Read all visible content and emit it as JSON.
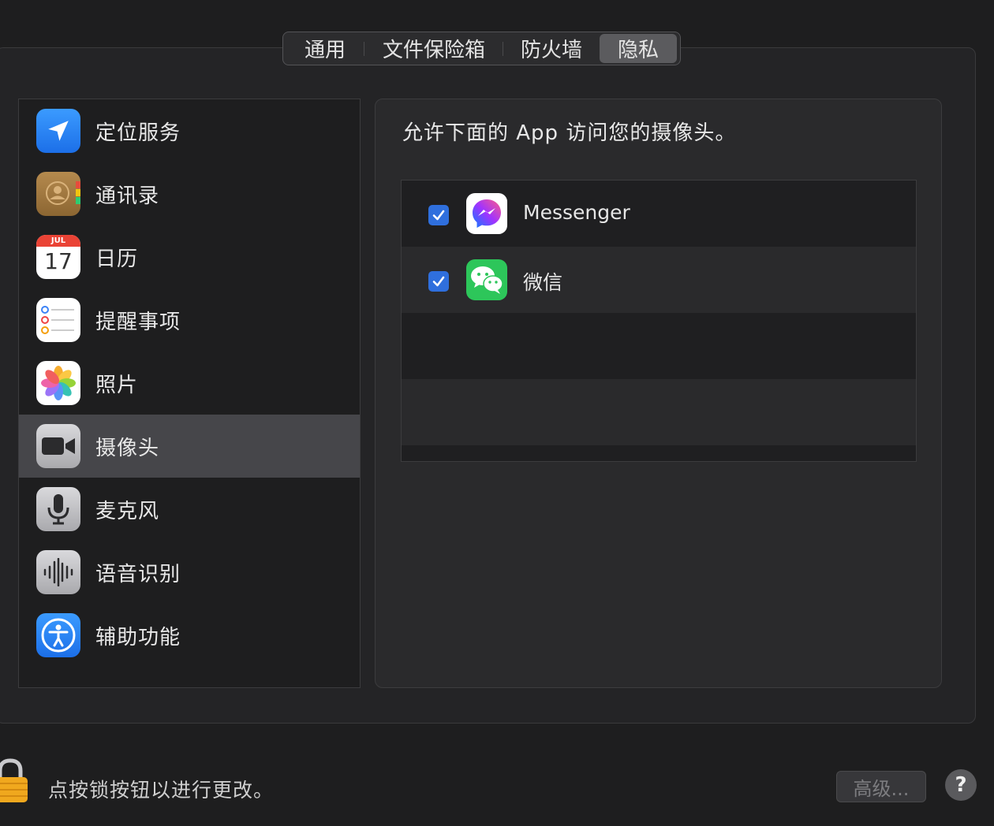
{
  "tabs": [
    {
      "label": "通用"
    },
    {
      "label": "文件保险箱"
    },
    {
      "label": "防火墙"
    },
    {
      "label": "隐私",
      "active": true
    }
  ],
  "sidebar": {
    "items": [
      {
        "label": "定位服务",
        "icon": "location-arrow-icon"
      },
      {
        "label": "通讯录",
        "icon": "contacts-icon"
      },
      {
        "label": "日历",
        "icon": "calendar-icon",
        "month": "JUL",
        "day": "17"
      },
      {
        "label": "提醒事项",
        "icon": "reminders-icon"
      },
      {
        "label": "照片",
        "icon": "photos-icon"
      },
      {
        "label": "摄像头",
        "icon": "camera-icon",
        "selected": true
      },
      {
        "label": "麦克风",
        "icon": "microphone-icon"
      },
      {
        "label": "语音识别",
        "icon": "speech-recognition-icon"
      },
      {
        "label": "辅助功能",
        "icon": "accessibility-icon"
      }
    ]
  },
  "panel": {
    "title": "允许下面的 App 访问您的摄像头。",
    "apps": [
      {
        "name": "Messenger",
        "checked": true,
        "icon": "messenger-icon"
      },
      {
        "name": "微信",
        "checked": true,
        "icon": "wechat-icon"
      }
    ]
  },
  "footer": {
    "lock_text": "点按锁按钮以进行更改。",
    "advanced_label": "高级...",
    "help_label": "?"
  },
  "colors": {
    "accent": "#2f6fdd",
    "selection": "#46464a",
    "background": "#1e1e1f"
  }
}
